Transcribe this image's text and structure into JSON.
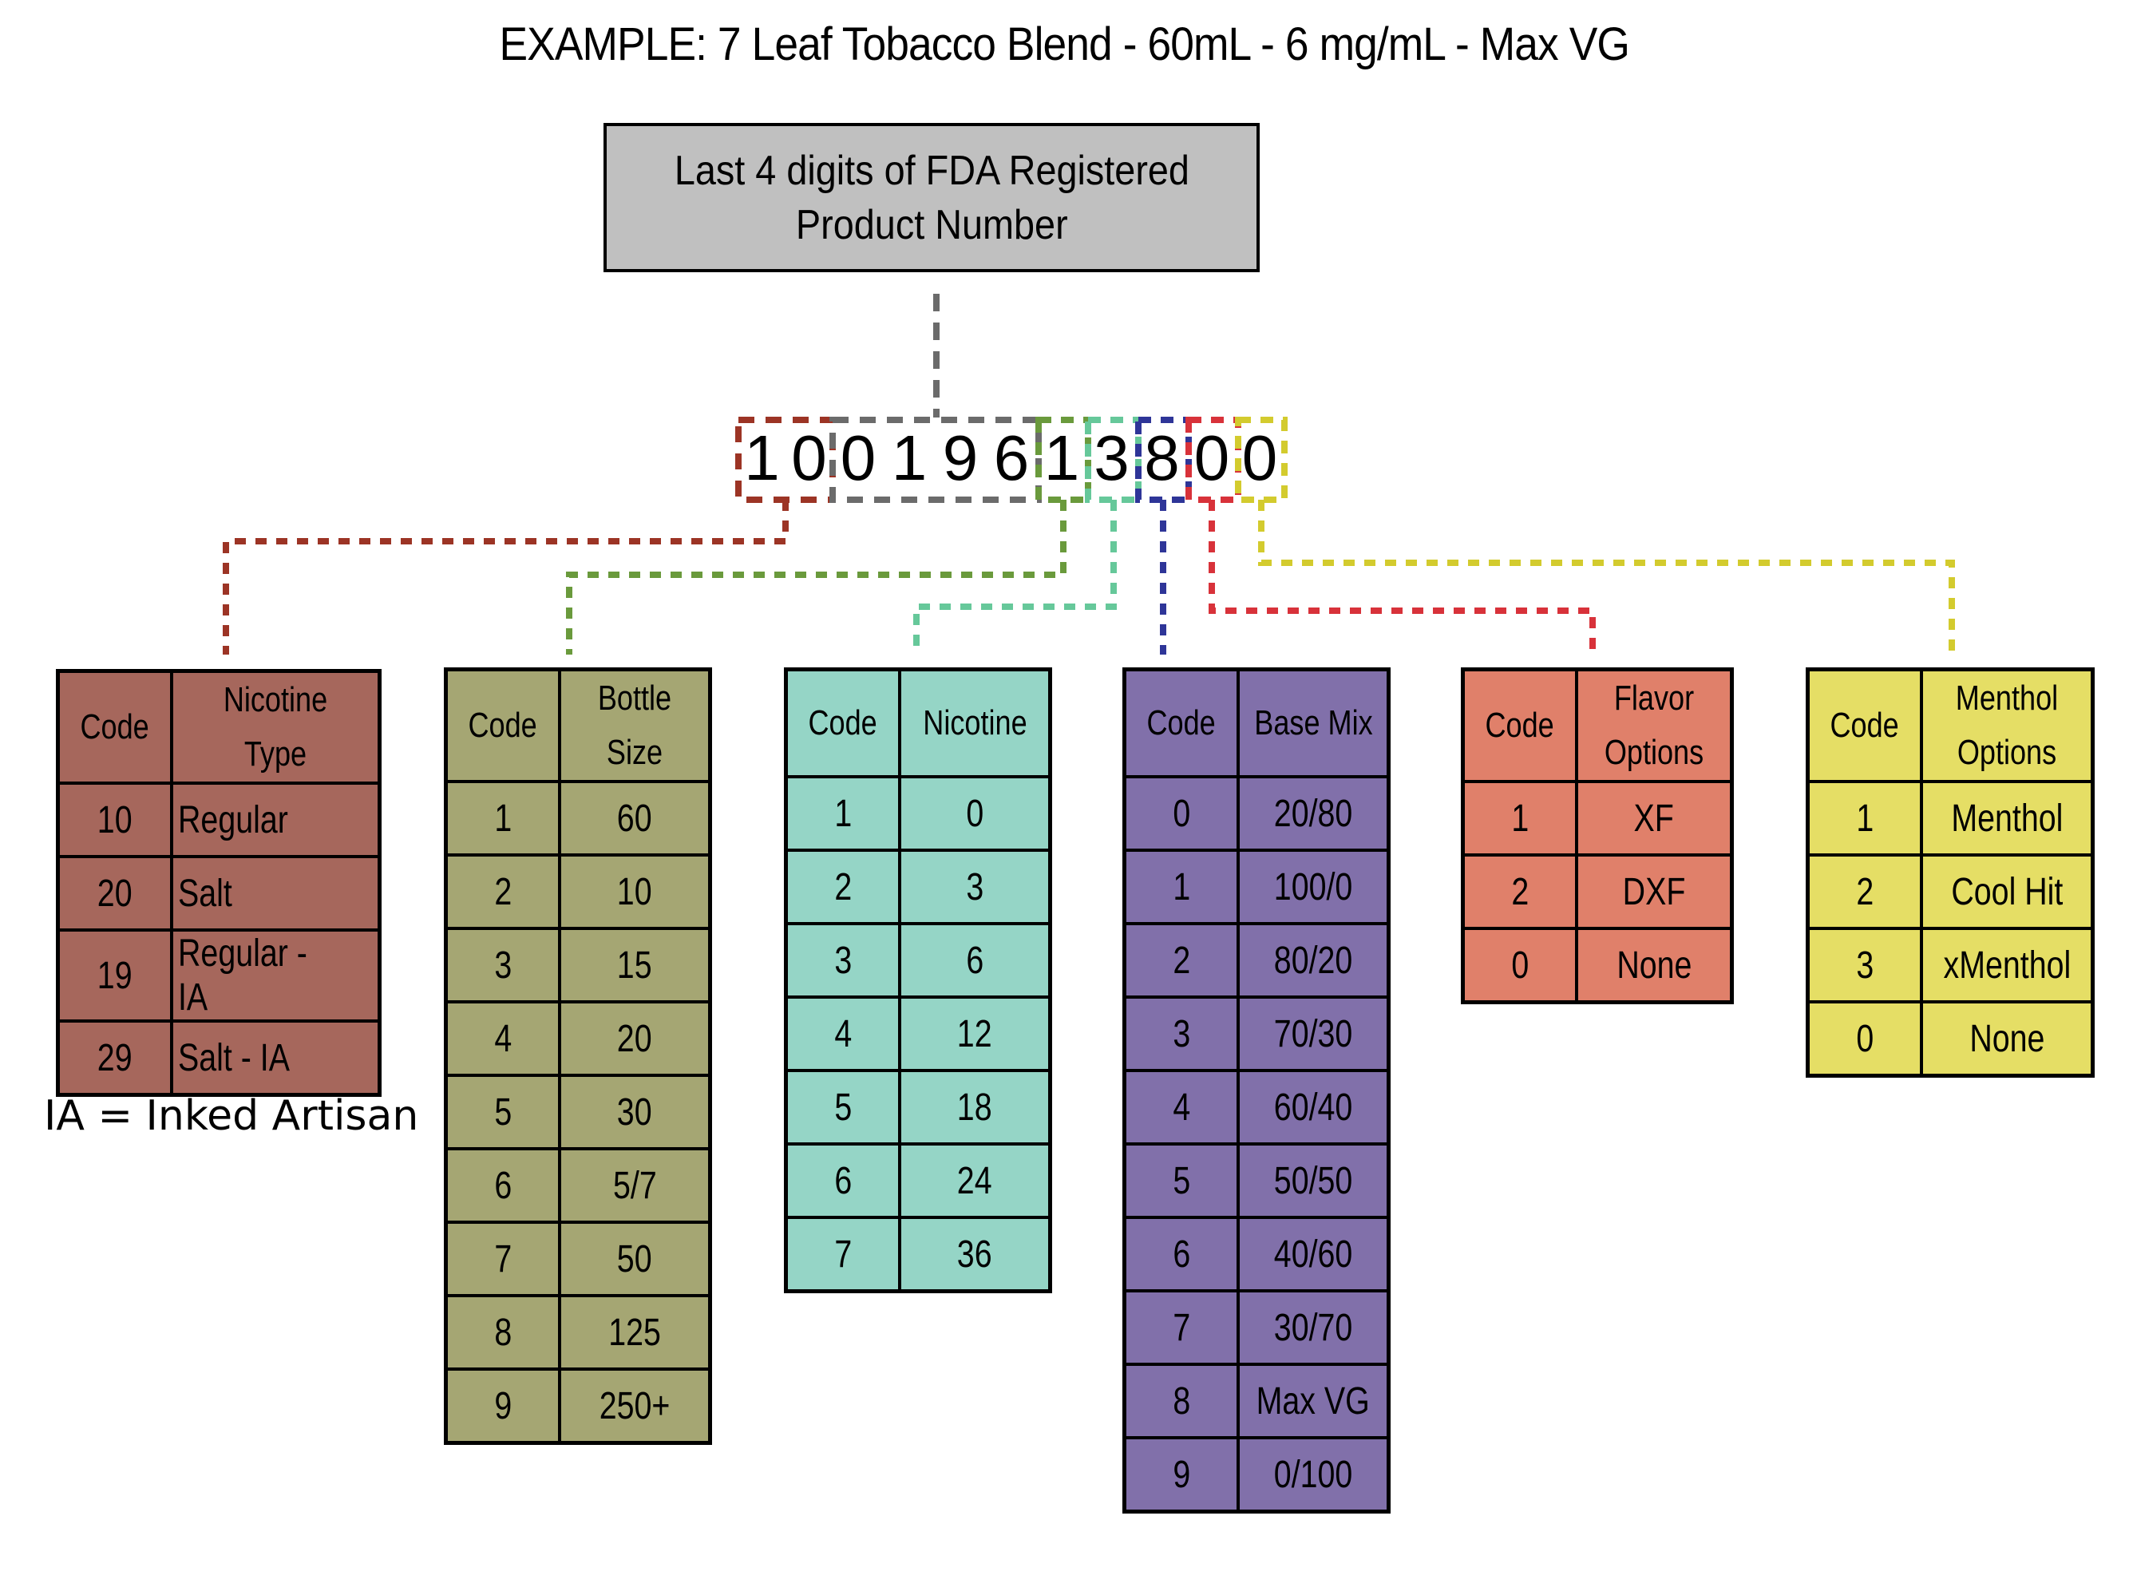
{
  "title": "EXAMPLE:  7 Leaf Tobacco Blend - 60mL - 6 mg/mL - Max VG",
  "fda_box": {
    "line1": "Last 4 digits of FDA Registered",
    "line2": "Product Number"
  },
  "product_code": {
    "digits": [
      "1",
      "0",
      "0",
      "1",
      "9",
      "6",
      "1",
      "3",
      "8",
      "0",
      "0"
    ],
    "segments": [
      {
        "name": "nicotine-type",
        "digits": "10",
        "color": "#9c3425"
      },
      {
        "name": "fda-number",
        "digits": "0196",
        "color": "#6b6b6b"
      },
      {
        "name": "bottle-size",
        "digits": "1",
        "color": "#6a9a3c"
      },
      {
        "name": "nicotine",
        "digits": "3",
        "color": "#66c89a"
      },
      {
        "name": "base-mix",
        "digits": "8",
        "color": "#2e3598"
      },
      {
        "name": "flavor-options",
        "digits": "0",
        "color": "#d8323a"
      },
      {
        "name": "menthol-options",
        "digits": "0",
        "color": "#d3cb2e"
      }
    ]
  },
  "tables": {
    "nicotine_type": {
      "color": "#a6675c",
      "headers": [
        "Code",
        "Nicotine Type"
      ],
      "rows": [
        [
          "10",
          "Regular"
        ],
        [
          "20",
          "Salt"
        ],
        [
          "19",
          "Regular - IA"
        ],
        [
          "29",
          "Salt - IA"
        ]
      ]
    },
    "bottle_size": {
      "color": "#a5a673",
      "headers": [
        "Code",
        "Bottle Size"
      ],
      "rows": [
        [
          "1",
          "60"
        ],
        [
          "2",
          "10"
        ],
        [
          "3",
          "15"
        ],
        [
          "4",
          "20"
        ],
        [
          "5",
          "30"
        ],
        [
          "6",
          "5/7"
        ],
        [
          "7",
          "50"
        ],
        [
          "8",
          "125"
        ],
        [
          "9",
          "250+"
        ]
      ]
    },
    "nicotine": {
      "color": "#95d5c6",
      "headers": [
        "Code",
        "Nicotine"
      ],
      "rows": [
        [
          "1",
          "0"
        ],
        [
          "2",
          "3"
        ],
        [
          "3",
          "6"
        ],
        [
          "4",
          "12"
        ],
        [
          "5",
          "18"
        ],
        [
          "6",
          "24"
        ],
        [
          "7",
          "36"
        ]
      ]
    },
    "base_mix": {
      "color": "#8170aa",
      "headers": [
        "Code",
        "Base Mix"
      ],
      "rows": [
        [
          "0",
          "20/80"
        ],
        [
          "1",
          "100/0"
        ],
        [
          "2",
          "80/20"
        ],
        [
          "3",
          "70/30"
        ],
        [
          "4",
          "60/40"
        ],
        [
          "5",
          "50/50"
        ],
        [
          "6",
          "40/60"
        ],
        [
          "7",
          "30/70"
        ],
        [
          "8",
          "Max VG"
        ],
        [
          "9",
          "0/100"
        ]
      ]
    },
    "flavor_options": {
      "color": "#e0806a",
      "headers": [
        "Code",
        "Flavor Options"
      ],
      "rows": [
        [
          "1",
          "XF"
        ],
        [
          "2",
          "DXF"
        ],
        [
          "0",
          "None"
        ]
      ]
    },
    "menthol_options": {
      "color": "#e5de65",
      "headers": [
        "Code",
        "Menthol Options"
      ],
      "rows": [
        [
          "1",
          "Menthol"
        ],
        [
          "2",
          "Cool Hit"
        ],
        [
          "3",
          "xMenthol"
        ],
        [
          "0",
          "None"
        ]
      ]
    }
  },
  "note": "IA = Inked Artisan"
}
